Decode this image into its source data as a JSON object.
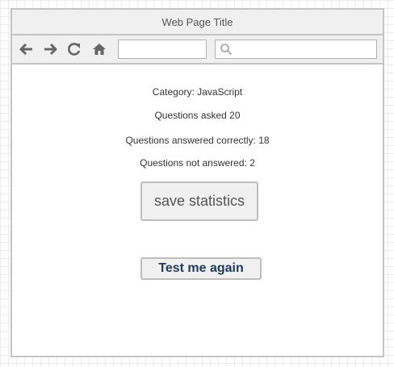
{
  "window": {
    "title": "Web Page Title"
  },
  "toolbar": {
    "icons": [
      "back-arrow-icon",
      "forward-arrow-icon",
      "reload-icon",
      "home-icon",
      "search-icon"
    ],
    "url_value": "",
    "search_value": ""
  },
  "stats": {
    "category": "Category: JavaScript",
    "asked": "Questions asked 20",
    "correct": "Questions answered correctly: 18",
    "not_answered": "Questions not answered: 2"
  },
  "buttons": {
    "save_label": "save statistics",
    "test_again_label": "Test me again"
  },
  "colors": {
    "chrome_background": "#f0f0f0",
    "chrome_border": "#c4c4c4",
    "icon": "#666666",
    "test_again_text": "#1f3b5c"
  }
}
